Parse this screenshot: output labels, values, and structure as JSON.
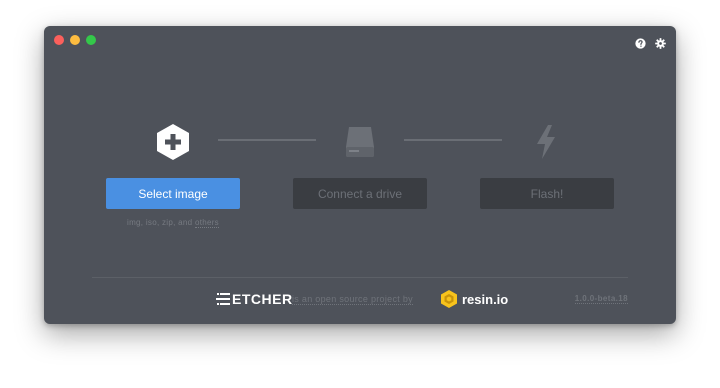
{
  "window": {
    "controls": [
      "close",
      "minimize",
      "zoom"
    ],
    "top_right_icons": [
      "help-icon",
      "settings-icon"
    ]
  },
  "steps": {
    "icons": [
      "plus-icon",
      "drive-icon",
      "flash-icon"
    ],
    "select_image_label": "Select image",
    "connect_drive_label": "Connect a drive",
    "flash_label": "Flash!",
    "image_formats_prefix": "img, iso, zip, and ",
    "image_formats_others": "others"
  },
  "footer": {
    "logo_text": "ETCHER",
    "tagline": "is an open source project by",
    "company": "resin.io",
    "version": "1.0.0-beta.18"
  },
  "colors": {
    "window_bg": "#4e525a",
    "primary_button": "#4a90e2",
    "disabled_button": "#3a3d42",
    "brand_yellow": "#f8c31c"
  }
}
